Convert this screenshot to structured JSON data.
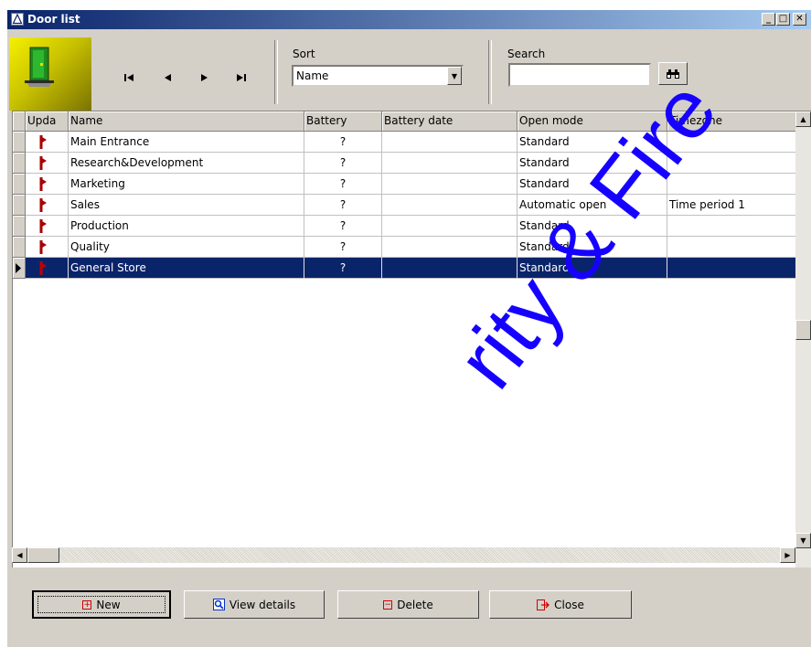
{
  "window": {
    "title": "Door list",
    "controls": {
      "minimize": "_",
      "maximize": "□",
      "close": "✕"
    }
  },
  "toolbar": {
    "logo_icon": "door-icon",
    "nav": [
      {
        "name": "first-record-icon",
        "glyph": "▎◀"
      },
      {
        "name": "previous-record-icon",
        "glyph": "◀"
      },
      {
        "name": "next-record-icon",
        "glyph": "▶"
      },
      {
        "name": "last-record-icon",
        "glyph": "▶▎"
      }
    ],
    "sort": {
      "label": "Sort",
      "value": "Name"
    },
    "search": {
      "label": "Search",
      "value": "",
      "button_icon": "binoculars-icon"
    }
  },
  "grid": {
    "columns": [
      "Upda",
      "Name",
      "Battery",
      "Battery date",
      "Open mode",
      "Timezone"
    ],
    "rows": [
      {
        "name": "Main Entrance",
        "battery": "?",
        "battery_date": "",
        "open_mode": "Standard",
        "timezone": ""
      },
      {
        "name": "Research&Development",
        "battery": "?",
        "battery_date": "",
        "open_mode": "Standard",
        "timezone": ""
      },
      {
        "name": "Marketing",
        "battery": "?",
        "battery_date": "",
        "open_mode": "Standard",
        "timezone": ""
      },
      {
        "name": "Sales",
        "battery": "?",
        "battery_date": "",
        "open_mode": "Automatic open",
        "timezone": "Time period 1"
      },
      {
        "name": "Production",
        "battery": "?",
        "battery_date": "",
        "open_mode": "Standard",
        "timezone": ""
      },
      {
        "name": "Quality",
        "battery": "?",
        "battery_date": "",
        "open_mode": "Standard",
        "timezone": ""
      },
      {
        "name": "General Store",
        "battery": "?",
        "battery_date": "",
        "open_mode": "Standard",
        "timezone": ""
      }
    ],
    "selected_row": 6,
    "update_icon": "red-key-icon"
  },
  "buttons": {
    "new": "New",
    "view_details": "View details",
    "delete": "Delete",
    "close": "Close"
  },
  "watermark": "rity & Fire",
  "colors": {
    "selection": "#0a246a",
    "title_gradient_start": "#0a246a",
    "title_gradient_end": "#a6caf0",
    "face": "#d4d0c8",
    "watermark": "#1600ff"
  }
}
